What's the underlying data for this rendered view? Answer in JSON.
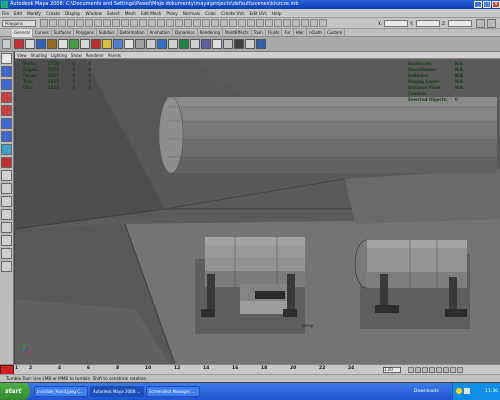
{
  "window": {
    "title": "Autodesk Maya 2008: C:\\Documents and Settings\\Pawel\\Moje dokumenty\\maya\\projects\\default\\scenes\\kiszcze.mb",
    "minimize": "_",
    "maximize": "□",
    "close": "×"
  },
  "menubar": {
    "items": [
      "File",
      "Edit",
      "Modify",
      "Create",
      "Display",
      "Window",
      "Select",
      "Mesh",
      "Edit Mesh",
      "Proxy",
      "Normals",
      "Color",
      "Create UVs",
      "Edit UVs",
      "Help"
    ]
  },
  "statusline": {
    "mode": "Polygons",
    "x_label": "X:",
    "y_label": "Y:",
    "z_label": "Z:"
  },
  "shelf": {
    "tabs": [
      "General",
      "Curves",
      "Surfaces",
      "Polygons",
      "Subdivs",
      "Deformation",
      "Animation",
      "Dynamics",
      "Rendering",
      "PaintEffects",
      "Toon",
      "Fluids",
      "Fur",
      "Hair",
      "nCloth",
      "Custom"
    ],
    "active_tab": "General",
    "icon_colors": [
      "#c83030",
      "#d8d8d8",
      "#3060c0",
      "#9a6a20",
      "#e0e0e0",
      "#40a040",
      "#d8d8d8",
      "#c03030",
      "#d8c040",
      "#5080d0",
      "#e0e0e0",
      "#a0a0a0",
      "#d0d0d0",
      "#3070c0",
      "#d0d0d0",
      "#208040",
      "#d0d0d0",
      "#6060a0",
      "#e0e0e0",
      "#c0c0c0",
      "#404040",
      "#d0d0d0",
      "#3060b0"
    ]
  },
  "toolbox": {
    "icon_colors": [
      "#e8e8e8",
      "#3a6ad0",
      "#3a6ad0",
      "#d04040",
      "#d04040",
      "#3a6ad0",
      "#3a6ad0",
      "#40a0d0",
      "#c03030",
      "#d0d0d0",
      "#d0d0d0",
      "#d0d0d0",
      "#d0d0d0",
      "#d0d0d0",
      "#d0d0d0",
      "#d0d0d0",
      "#d0d0d0"
    ]
  },
  "panel": {
    "menu": [
      "View",
      "Shading",
      "Lighting",
      "Show",
      "Renderer",
      "Panels"
    ],
    "hud_left": [
      {
        "label": "Verts:",
        "v1": "2740",
        "v2": "0",
        "v3": "0"
      },
      {
        "label": "Edges:",
        "v1": "5254",
        "v2": "0",
        "v3": "0"
      },
      {
        "label": "Faces:",
        "v1": "2657",
        "v2": "0",
        "v3": "0"
      },
      {
        "label": "Tris:",
        "v1": "4950",
        "v2": "0",
        "v3": "0"
      },
      {
        "label": "UVs:",
        "v1": "2428",
        "v2": "0",
        "v3": "0"
      }
    ],
    "hud_right": [
      {
        "label": "Backfaces:",
        "value": "N/A"
      },
      {
        "label": "Smoothness:",
        "value": "N/A"
      },
      {
        "label": "Instance:",
        "value": "N/A"
      },
      {
        "label": "Display Layer:",
        "value": "N/A"
      },
      {
        "label": "Distance From Camera:",
        "value": "N/A"
      },
      {
        "label": "Selected Objects:",
        "value": "0"
      }
    ],
    "camera_name": "persp"
  },
  "timeslider": {
    "ticks": [
      "1",
      "2",
      "4",
      "6",
      "8",
      "10",
      "12",
      "14",
      "16",
      "18",
      "20",
      "22",
      "24"
    ],
    "current": "1.00"
  },
  "helpline": {
    "text": "Tumble Tool: Use LMB or MMB to tumble. Shift to constrain rotation."
  },
  "taskbar": {
    "start": "start",
    "tasks": [
      "Invisible_Hand.jpeg C...",
      "Autodesk Maya 2008:...",
      "Screenshot Manager ..."
    ],
    "active_task": 1,
    "downloads": "Downloads",
    "clock": "11:36"
  }
}
